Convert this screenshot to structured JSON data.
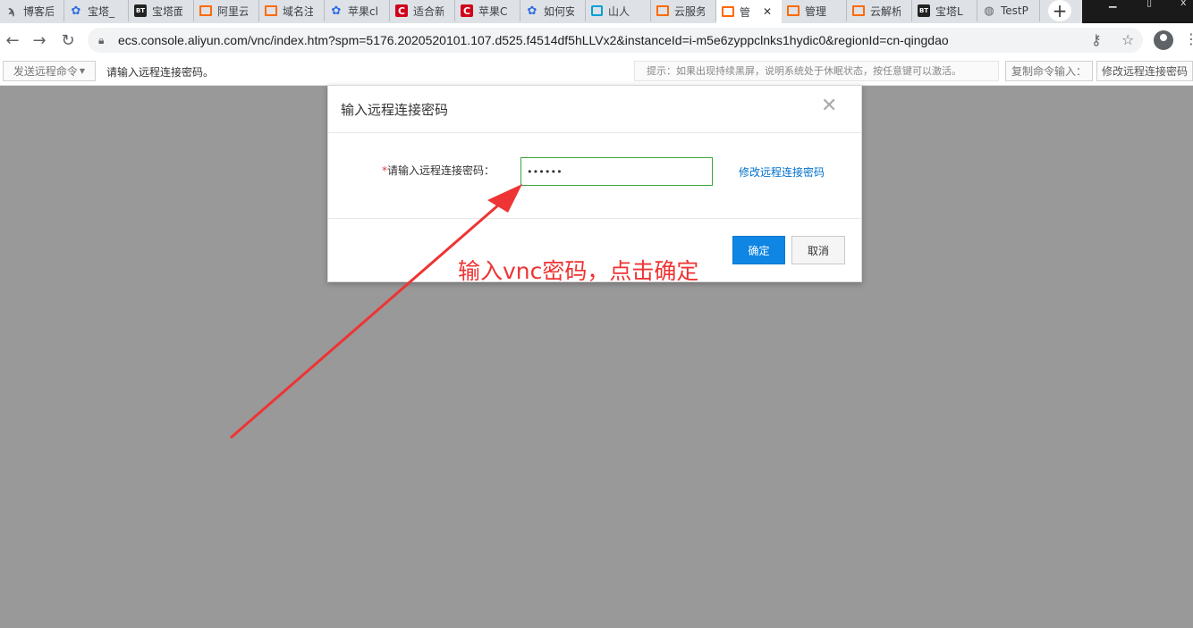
{
  "browser": {
    "tabs": [
      {
        "title": "博客后",
        "favicon": "blog-icon",
        "kind": "blog"
      },
      {
        "title": "宝塔_",
        "favicon": "baidu-paw-icon",
        "kind": "baidu"
      },
      {
        "title": "宝塔面",
        "favicon": "bt-icon",
        "kind": "bt"
      },
      {
        "title": "阿里云",
        "favicon": "aliyun-icon",
        "kind": "ali"
      },
      {
        "title": "域名注",
        "favicon": "aliyun-icon",
        "kind": "ali"
      },
      {
        "title": "苹果cl",
        "favicon": "baidu-paw-icon",
        "kind": "baidu"
      },
      {
        "title": "适合新",
        "favicon": "c-logo-icon",
        "kind": "c"
      },
      {
        "title": "苹果C",
        "favicon": "c-logo-icon",
        "kind": "c"
      },
      {
        "title": "如何安",
        "favicon": "baidu-paw-icon",
        "kind": "baidu"
      },
      {
        "title": "山人",
        "favicon": "bilibili-icon",
        "kind": "bili"
      },
      {
        "title": "云服务",
        "favicon": "aliyun-icon",
        "kind": "ali"
      },
      {
        "title": "管",
        "favicon": "aliyun-icon",
        "kind": "ali",
        "active": true
      },
      {
        "title": "管理",
        "favicon": "aliyun-icon",
        "kind": "ali"
      },
      {
        "title": "云解析",
        "favicon": "aliyun-icon",
        "kind": "ali"
      },
      {
        "title": "宝塔L",
        "favicon": "bt-icon",
        "kind": "bt"
      },
      {
        "title": "TestP",
        "favicon": "globe-icon",
        "kind": "globe"
      }
    ],
    "new_tab_glyph": "+",
    "url": "ecs.console.aliyun.com/vnc/index.htm?spm=5176.2020520101.107.d525.f4514df5hLLVx2&instanceId=i-m5e6zyppclnks1hydic0&regionId=cn-qingdao"
  },
  "vnc_toolbar": {
    "send_command_label": "发送远程命令",
    "status_text": "请输入远程连接密码。",
    "hint_text": "提示：如果出现持续黑屏，说明系统处于休眠状态，按任意键可以激活。",
    "copy_command_label": "复制命令输入：",
    "modify_password_label": "修改远程连接密码"
  },
  "dialog": {
    "title": "输入远程连接密码",
    "required_mark": "*",
    "password_label": "请输入远程连接密码：",
    "password_value": "••••••",
    "modify_link": "修改远程连接密码",
    "ok_label": "确定",
    "cancel_label": "取消"
  },
  "annotation": {
    "text": "输入vnc密码，点击确定",
    "color": "#ee3434"
  },
  "colors": {
    "primary_button": "#0f86e4",
    "input_focus_border": "#3aa53a",
    "link": "#0070cc"
  }
}
